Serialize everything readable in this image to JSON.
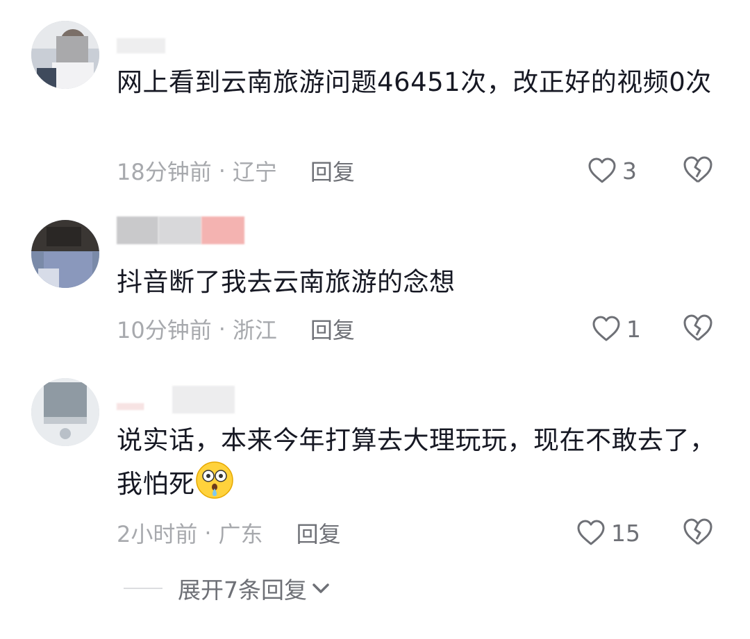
{
  "comments": [
    {
      "text": "网上看到云南旅游问题46451次，改正好的视频0次",
      "time": "18分钟前",
      "location": "辽宁",
      "reply_label": "回复",
      "likes": "3",
      "avatar": "blurred-photo"
    },
    {
      "text": "抖音断了我去云南旅游的念想",
      "time": "10分钟前",
      "location": "浙江",
      "reply_label": "回复",
      "likes": "1",
      "avatar": "blurred-photo"
    },
    {
      "text": "说实话，本来今年打算去大理玩玩，现在不敢去了，我怕死",
      "time": "2小时前",
      "location": "广东",
      "reply_label": "回复",
      "likes": "15",
      "emoji": "scared-crying-face-emoji",
      "avatar": "blurred-photo"
    }
  ],
  "separator": "·",
  "expand_replies": "展开7条回复",
  "colors": {
    "text": "#161823",
    "meta": "#a7a9ad",
    "action": "#6e7076",
    "background": "#ffffff"
  }
}
